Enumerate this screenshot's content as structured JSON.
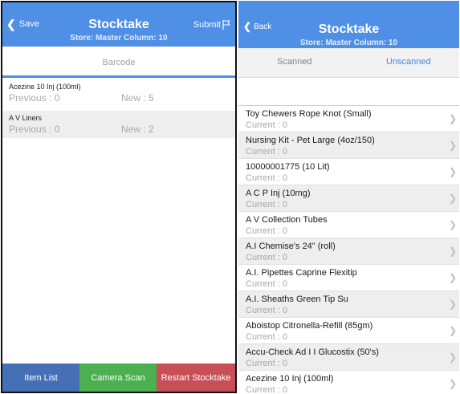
{
  "left": {
    "header": {
      "back_label": "Save",
      "title": "Stocktake",
      "subtitle": "Store: Master  Column: 10",
      "action_label": "Submit"
    },
    "barcode_placeholder": "Barcode",
    "items": [
      {
        "name": "Acezine 10 Inj (100ml)",
        "previous": "Previous : 0",
        "new": "New : 5"
      },
      {
        "name": "A V Liners",
        "previous": "Previous : 0",
        "new": "New : 2"
      }
    ],
    "bottom_buttons": [
      {
        "label": "Item List",
        "color": "#4670b6"
      },
      {
        "label": "Camera Scan",
        "color": "#4caf50"
      },
      {
        "label": "Restart Stocktake",
        "color": "#c84f55"
      }
    ]
  },
  "right": {
    "header": {
      "back_label": "Back",
      "title": "Stocktake",
      "subtitle": "Store: Master  Column: 10"
    },
    "tabs": {
      "scanned": "Scanned",
      "unscanned": "Unscanned"
    },
    "items": [
      {
        "name": "Toy Chewers Rope Knot (Small)",
        "current": "Current : 0"
      },
      {
        "name": "Nursing Kit - Pet Large (4oz/150)",
        "current": "Current : 0"
      },
      {
        "name": "10000001775 (10 Lit)",
        "current": "Current : 0"
      },
      {
        "name": "A C P Inj (10mg)",
        "current": "Current : 0"
      },
      {
        "name": "A V Collection Tubes",
        "current": "Current : 0"
      },
      {
        "name": "A.I Chemise's 24\" (roll)",
        "current": "Current : 0"
      },
      {
        "name": "A.I. Pipettes Caprine Flexitip",
        "current": "Current : 0"
      },
      {
        "name": "A.I. Sheaths Green Tip Su",
        "current": "Current : 0"
      },
      {
        "name": "Aboistop Citronella-Refill (85gm)",
        "current": "Current : 0"
      },
      {
        "name": "Accu-Check Ad I I Glucostix (50's)",
        "current": "Current : 0"
      },
      {
        "name": "Acezine 10 Inj (100ml)",
        "current": "Current : 0"
      }
    ]
  },
  "colors": {
    "header_blue": "#4f8fe6",
    "accent_blue": "#3a86e0"
  }
}
